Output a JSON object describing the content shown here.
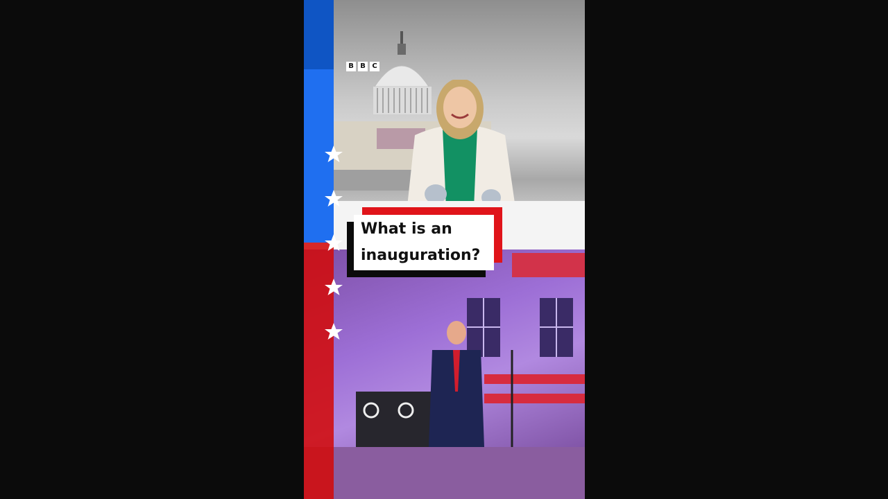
{
  "video": {
    "title_line1": "What is an",
    "title_line2": "inauguration?",
    "logo_letters": [
      "B",
      "B",
      "C"
    ]
  },
  "colors": {
    "flag_blue": "#1f6ff0",
    "flag_red": "#d20b0b",
    "title_accent_red": "#e0141a",
    "background": "#0b0b0b"
  },
  "icons": [
    "bbc-logo",
    "star-icon"
  ]
}
